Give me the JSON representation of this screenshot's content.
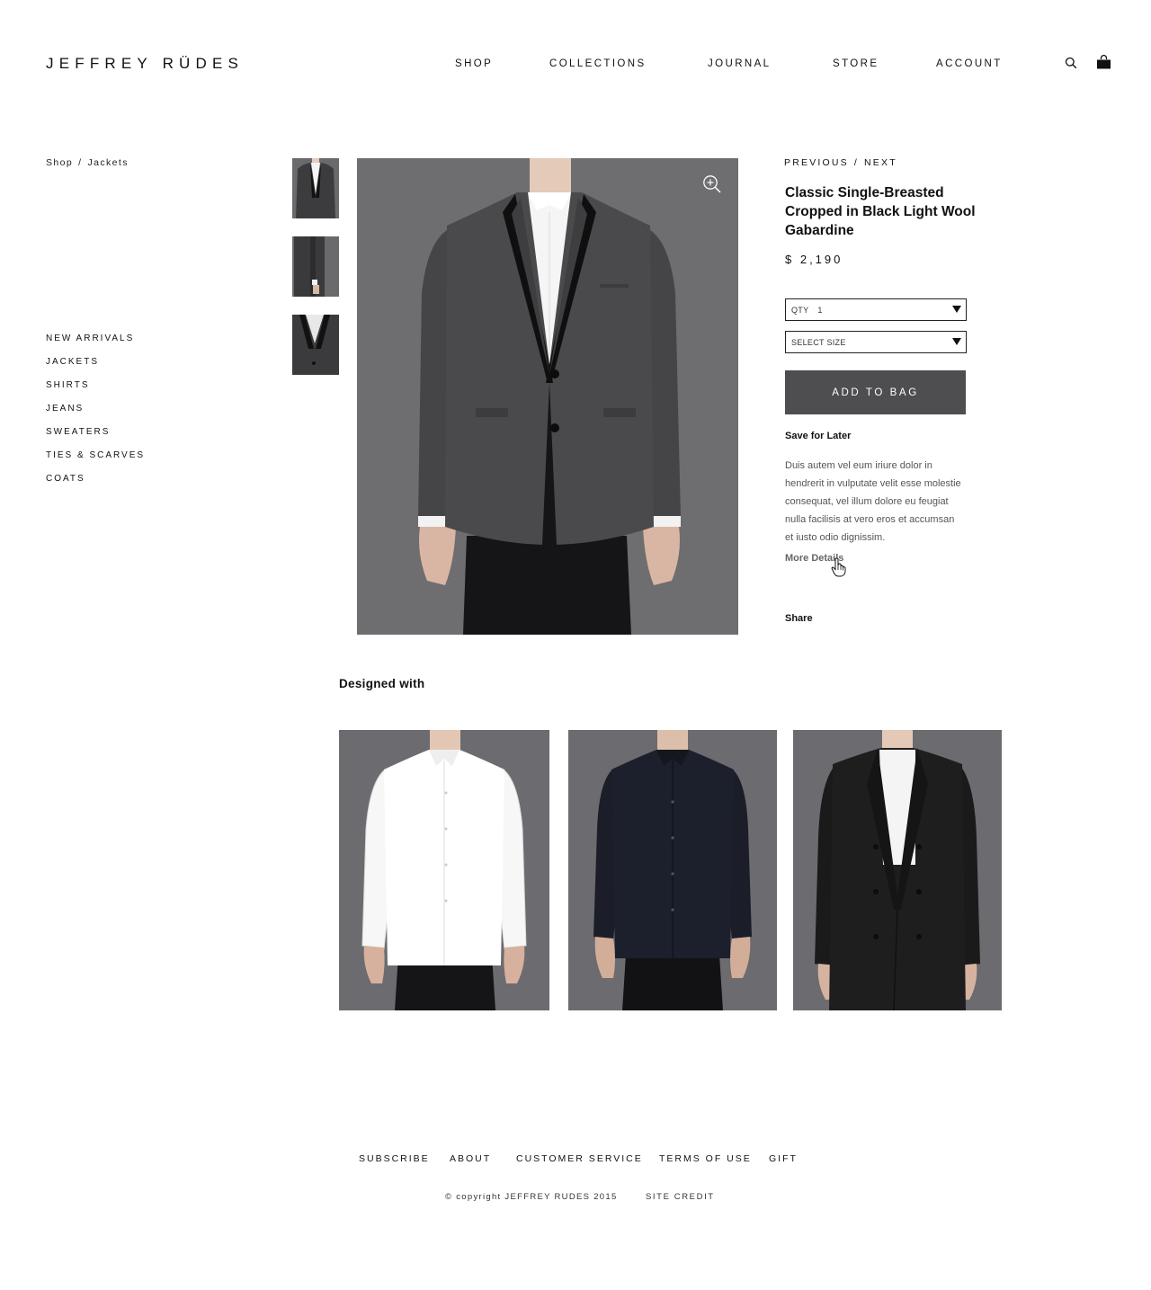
{
  "brand": {
    "logo_text": "JEFFREY RÜDES"
  },
  "nav": {
    "items": [
      {
        "label": "SHOP"
      },
      {
        "label": "COLLECTIONS"
      },
      {
        "label": "JOURNAL"
      },
      {
        "label": "STORE"
      },
      {
        "label": "ACCOUNT"
      }
    ],
    "search_icon": "search-icon",
    "bag_icon": "shopping-bag-icon"
  },
  "breadcrumb": {
    "items": [
      "Shop",
      "Jackets"
    ],
    "separator": "/"
  },
  "sidebar": {
    "items": [
      {
        "label": "NEW ARRIVALS"
      },
      {
        "label": "JACKETS"
      },
      {
        "label": "SHIRTS"
      },
      {
        "label": "JEANS"
      },
      {
        "label": "SWEATERS"
      },
      {
        "label": "TIES & SCARVES"
      },
      {
        "label": "COATS"
      }
    ]
  },
  "product": {
    "prev_label": "PREVIOUS",
    "pager_separator": "/",
    "next_label": "NEXT",
    "title": "Classic Single-Breasted Cropped in Black Light Wool Gabardine",
    "price": "$ 2,190",
    "qty_label": "QTY",
    "qty_value": "1",
    "size_placeholder": "SELECT SIZE",
    "add_to_bag": "ADD TO BAG",
    "save_for_later": "Save for Later",
    "description": "Duis autem vel eum iriure dolor in hendrerit in vulputate velit esse molestie consequat, vel illum dolore eu feugiat nulla facilisis at vero eros et accumsan et iusto odio dignissim.",
    "more_details": "More Details",
    "share": "Share",
    "zoom_icon": "zoom-in-icon"
  },
  "designed_with": {
    "heading": "Designed with"
  },
  "footer": {
    "links": [
      {
        "label": "SUBSCRIBE"
      },
      {
        "label": "ABOUT"
      },
      {
        "label": "CUSTOMER SERVICE"
      },
      {
        "label": "TERMS OF USE"
      },
      {
        "label": "GIFT"
      }
    ],
    "copyright": "© copyright JEFFREY RUDES 2015",
    "site_credit": "SITE CREDIT"
  },
  "colors": {
    "button_bg": "#4e4d50",
    "photo_backdrop": "#6e6d70",
    "text": "#111111"
  }
}
